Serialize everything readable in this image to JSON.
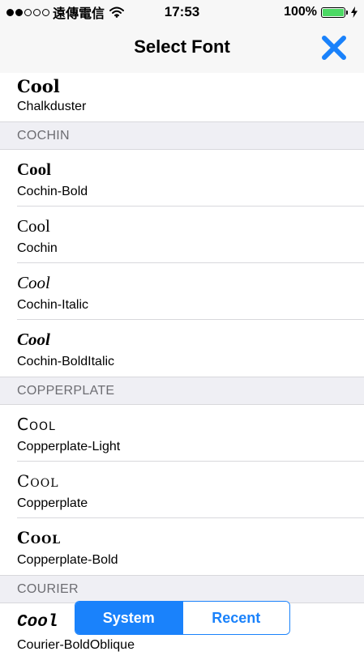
{
  "status": {
    "carrier": "遠傳電信",
    "time": "17:53",
    "battery_pct": "100%",
    "battery_level": 1.0,
    "signal_bars_filled": 2,
    "signal_bars_total": 5
  },
  "nav": {
    "title": "Select Font",
    "close_icon": "close-x-icon",
    "accent": "#1a82fb"
  },
  "list": {
    "partial_top": {
      "sample": "Cool",
      "name": "Chalkduster"
    },
    "sections": [
      {
        "header": "COCHIN",
        "items": [
          {
            "sample": "Cool",
            "name": "Cochin-Bold"
          },
          {
            "sample": "Cool",
            "name": "Cochin"
          },
          {
            "sample": "Cool",
            "name": "Cochin-Italic"
          },
          {
            "sample": "Cool",
            "name": "Cochin-BoldItalic"
          }
        ]
      },
      {
        "header": "COPPERPLATE",
        "items": [
          {
            "sample": "Cool",
            "name": "Copperplate-Light"
          },
          {
            "sample": "Cool",
            "name": "Copperplate"
          },
          {
            "sample": "Cool",
            "name": "Copperplate-Bold"
          }
        ]
      },
      {
        "header": "COURIER",
        "items": [
          {
            "sample": "Cool",
            "name": "Courier-BoldOblique"
          }
        ]
      }
    ]
  },
  "segmented": {
    "system_label": "System",
    "recent_label": "Recent",
    "selected": "System"
  }
}
